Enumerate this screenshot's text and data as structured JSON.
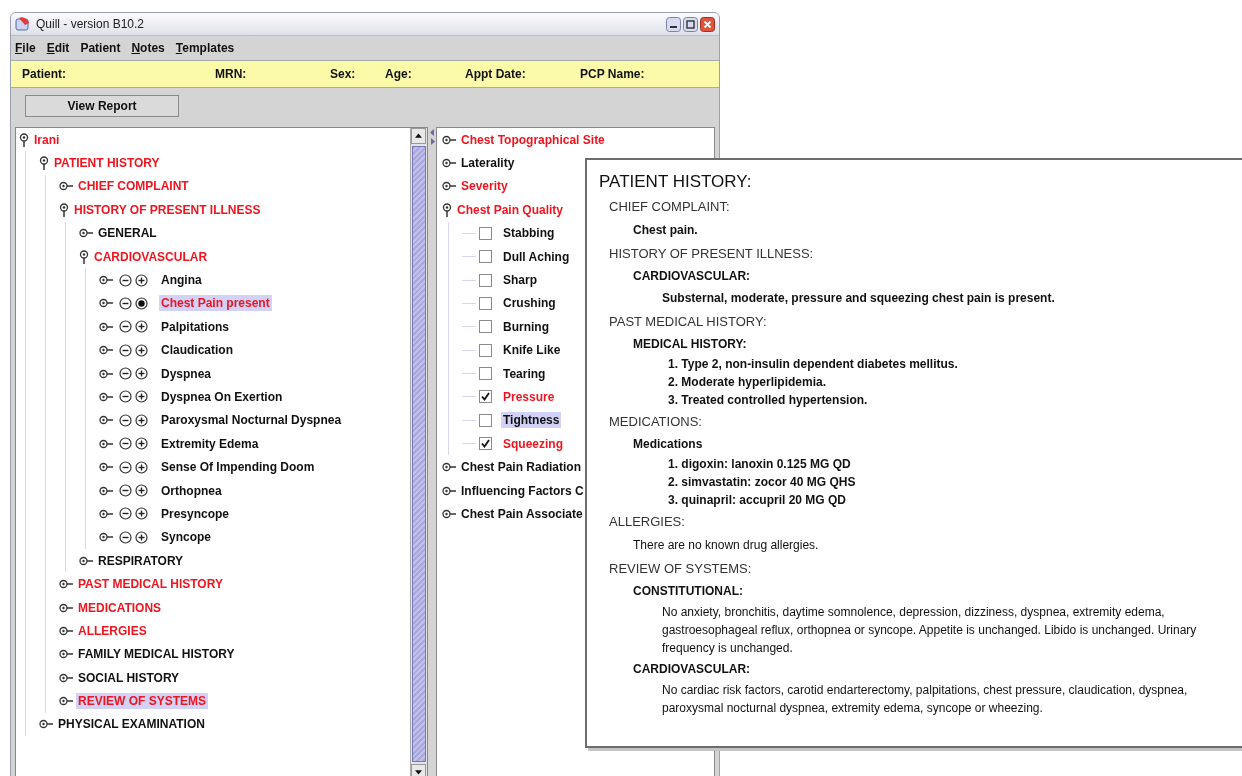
{
  "window": {
    "title": "Quill - version B10.2"
  },
  "menu": [
    {
      "label": "File",
      "underlined": true
    },
    {
      "label": "Edit",
      "underlined": true
    },
    {
      "label": "Patient",
      "underlined": false
    },
    {
      "label": "Notes",
      "underlined": true
    },
    {
      "label": "Templates",
      "underlined": true
    }
  ],
  "patient_bar": [
    "Patient:",
    "MRN:",
    "Sex:",
    "Age:",
    "Appt Date:",
    "PCP Name:"
  ],
  "toolbar": {
    "button": "View Report"
  },
  "outline": [
    {
      "kind": "section",
      "label": "Irani",
      "filled": true,
      "expanded": true,
      "selected": false,
      "children": [
        {
          "kind": "section",
          "label": "PATIENT HISTORY",
          "filled": true,
          "expanded": true,
          "selected": false,
          "children": [
            {
              "kind": "section",
              "label": "CHIEF COMPLAINT",
              "filled": true,
              "expanded": false,
              "selected": false
            },
            {
              "kind": "section",
              "label": "HISTORY OF PRESENT ILLNESS",
              "filled": true,
              "expanded": true,
              "selected": false,
              "children": [
                {
                  "kind": "section",
                  "label": "GENERAL",
                  "filled": false,
                  "expanded": false,
                  "selected": false
                },
                {
                  "kind": "section",
                  "label": "CARDIOVASCULAR",
                  "filled": true,
                  "expanded": true,
                  "selected": false,
                  "children": [
                    {
                      "kind": "finding",
                      "label": "Angina",
                      "present": false,
                      "selected": false
                    },
                    {
                      "kind": "finding",
                      "label": "Chest Pain present",
                      "present": true,
                      "selected": true
                    },
                    {
                      "kind": "finding",
                      "label": "Palpitations",
                      "present": false,
                      "selected": false
                    },
                    {
                      "kind": "finding",
                      "label": "Claudication",
                      "present": false,
                      "selected": false
                    },
                    {
                      "kind": "finding",
                      "label": "Dyspnea",
                      "present": false,
                      "selected": false
                    },
                    {
                      "kind": "finding",
                      "label": "Dyspnea On Exertion",
                      "present": false,
                      "selected": false
                    },
                    {
                      "kind": "finding",
                      "label": "Paroxysmal Nocturnal Dyspnea",
                      "present": false,
                      "selected": false
                    },
                    {
                      "kind": "finding",
                      "label": "Extremity Edema",
                      "present": false,
                      "selected": false
                    },
                    {
                      "kind": "finding",
                      "label": "Sense Of Impending Doom",
                      "present": false,
                      "selected": false
                    },
                    {
                      "kind": "finding",
                      "label": "Orthopnea",
                      "present": false,
                      "selected": false
                    },
                    {
                      "kind": "finding",
                      "label": "Presyncope",
                      "present": false,
                      "selected": false
                    },
                    {
                      "kind": "finding",
                      "label": "Syncope",
                      "present": false,
                      "selected": false
                    }
                  ]
                },
                {
                  "kind": "section",
                  "label": "RESPIRATORY",
                  "filled": false,
                  "expanded": false,
                  "selected": false
                }
              ]
            },
            {
              "kind": "section",
              "label": "PAST MEDICAL HISTORY",
              "filled": true,
              "expanded": false,
              "selected": false
            },
            {
              "kind": "section",
              "label": "MEDICATIONS",
              "filled": true,
              "expanded": false,
              "selected": false
            },
            {
              "kind": "section",
              "label": "ALLERGIES",
              "filled": true,
              "expanded": false,
              "selected": false
            },
            {
              "kind": "section",
              "label": "FAMILY MEDICAL HISTORY",
              "filled": false,
              "expanded": false,
              "selected": false
            },
            {
              "kind": "section",
              "label": "SOCIAL HISTORY",
              "filled": false,
              "expanded": false,
              "selected": false
            },
            {
              "kind": "section",
              "label": "REVIEW OF SYSTEMS",
              "filled": true,
              "expanded": false,
              "selected": true
            }
          ]
        },
        {
          "kind": "section",
          "label": "PHYSICAL EXAMINATION",
          "filled": false,
          "expanded": false,
          "selected": false
        }
      ]
    }
  ],
  "details": [
    {
      "kind": "section",
      "label": "Chest Topographical Site",
      "filled": true,
      "expanded": false,
      "selected": false
    },
    {
      "kind": "section",
      "label": "Laterality",
      "filled": false,
      "expanded": false,
      "selected": false
    },
    {
      "kind": "section",
      "label": "Severity",
      "filled": true,
      "expanded": false,
      "selected": false
    },
    {
      "kind": "section",
      "label": "Chest Pain Quality",
      "filled": true,
      "expanded": true,
      "selected": false,
      "children": [
        {
          "kind": "option",
          "label": "Stabbing",
          "checked": false,
          "selected": false
        },
        {
          "kind": "option",
          "label": "Dull Aching",
          "checked": false,
          "selected": false
        },
        {
          "kind": "option",
          "label": "Sharp",
          "checked": false,
          "selected": false
        },
        {
          "kind": "option",
          "label": "Crushing",
          "checked": false,
          "selected": false
        },
        {
          "kind": "option",
          "label": "Burning",
          "checked": false,
          "selected": false
        },
        {
          "kind": "option",
          "label": "Knife Like",
          "checked": false,
          "selected": false
        },
        {
          "kind": "option",
          "label": "Tearing",
          "checked": false,
          "selected": false
        },
        {
          "kind": "option",
          "label": "Pressure",
          "checked": true,
          "selected": false
        },
        {
          "kind": "option",
          "label": "Tightness",
          "checked": false,
          "selected": true
        },
        {
          "kind": "option",
          "label": "Squeezing",
          "checked": true,
          "selected": false
        }
      ]
    },
    {
      "kind": "section",
      "label": "Chest Pain Radiation",
      "filled": false,
      "expanded": false,
      "selected": false
    },
    {
      "kind": "section",
      "label": "Influencing Factors C",
      "filled": false,
      "expanded": false,
      "selected": false
    },
    {
      "kind": "section",
      "label": "Chest Pain Associate",
      "filled": false,
      "expanded": false,
      "selected": false
    }
  ],
  "report": {
    "title": "PATIENT HISTORY:",
    "sections": [
      {
        "heading": "CHIEF COMPLAINT:",
        "blocks": [
          {
            "kind": "statement",
            "text": "Chest pain."
          }
        ]
      },
      {
        "heading": "HISTORY OF PRESENT ILLNESS:",
        "blocks": [
          {
            "kind": "group",
            "title": "CARDIOVASCULAR:",
            "lines": [
              {
                "kind": "statement",
                "text": "Substernal, moderate, pressure and squeezing chest pain is present."
              }
            ]
          }
        ]
      },
      {
        "heading": "PAST MEDICAL HISTORY:",
        "blocks": [
          {
            "kind": "group",
            "title": "MEDICAL HISTORY:",
            "lines": [
              {
                "kind": "item",
                "text": "1. Type 2, non-insulin dependent diabetes mellitus."
              },
              {
                "kind": "item",
                "text": "2. Moderate hyperlipidemia."
              },
              {
                "kind": "item",
                "text": "3. Treated controlled hypertension."
              }
            ]
          }
        ]
      },
      {
        "heading": "MEDICATIONS:",
        "blocks": [
          {
            "kind": "group",
            "title": "Medications",
            "lines": [
              {
                "kind": "item",
                "text": "1. digoxin: lanoxin 0.125 MG QD"
              },
              {
                "kind": "item",
                "text": "2. simvastatin: zocor 40 MG QHS"
              },
              {
                "kind": "item",
                "text": "3. quinapril: accupril 20 MG QD"
              }
            ]
          }
        ]
      },
      {
        "heading": "ALLERGIES:",
        "blocks": [
          {
            "kind": "remark",
            "text": "There are no known drug allergies."
          }
        ]
      },
      {
        "heading": "REVIEW OF SYSTEMS:",
        "blocks": [
          {
            "kind": "group",
            "title": "CONSTITUTIONAL:",
            "lines": [
              {
                "kind": "narrative",
                "text": "No anxiety, bronchitis, daytime somnolence, depression, dizziness, dyspnea, extremity edema, gastroesophageal reflux, orthopnea or syncope. Appetite is unchanged. Libido is unchanged. Urinary frequency is unchanged."
              }
            ]
          },
          {
            "kind": "group",
            "title": "CARDIOVASCULAR:",
            "lines": [
              {
                "kind": "narrative",
                "text": "No cardiac risk factors, carotid endarterectomy, palpitations, chest pressure, claudication, dyspnea, paroxysmal nocturnal dyspnea, extremity edema, syncope or wheezing."
              }
            ]
          }
        ]
      }
    ]
  }
}
